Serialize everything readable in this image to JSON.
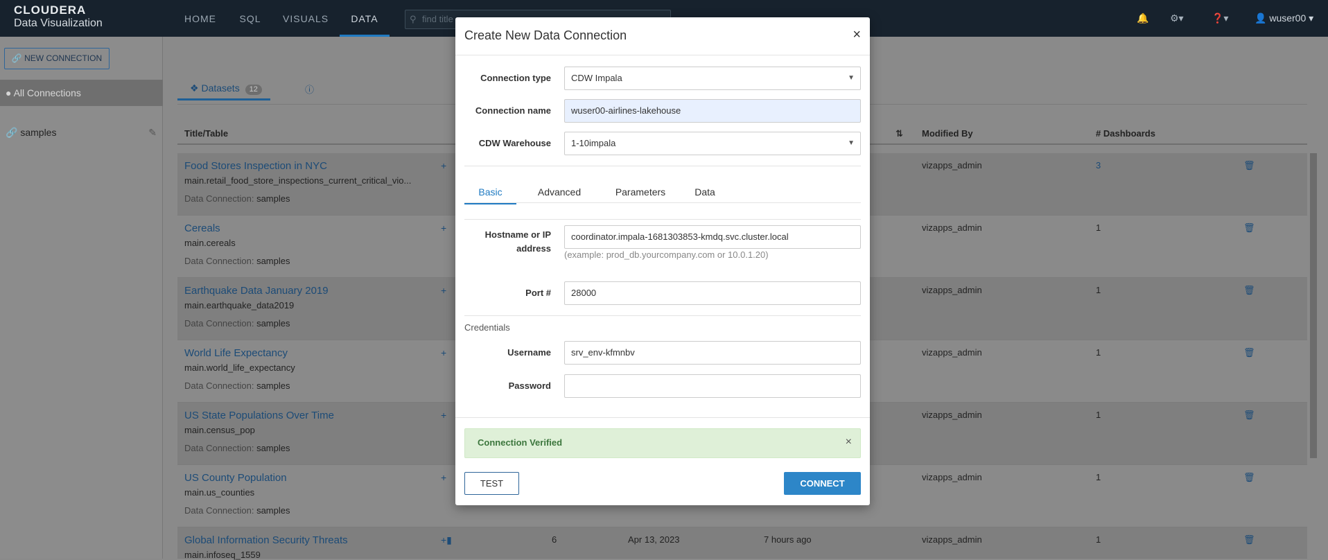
{
  "brand": {
    "line1": "CLOUDERA",
    "line2": "Data Visualization"
  },
  "nav": {
    "home": "HOME",
    "sql": "SQL",
    "visuals": "VISUALS",
    "data": "DATA"
  },
  "search": {
    "placeholder": "find title"
  },
  "user": {
    "name": "wuser00"
  },
  "sidebar": {
    "new_connection": "NEW CONNECTION",
    "all_connections": "All Connections",
    "connection": "samples"
  },
  "main": {
    "tab_datasets": "Datasets",
    "tab_count": "12",
    "columns": {
      "title": "Title/Table",
      "modified_by": "Modified By",
      "dashboards": "# Dashboards"
    },
    "dc_label": "Data Connection:",
    "rows": [
      {
        "title": "Food Stores Inspection in NYC",
        "table": "main.retail_food_store_inspections_current_critical_vio...",
        "conn": "samples",
        "modified_by": "vizapps_admin",
        "dashboards": "3"
      },
      {
        "title": "Cereals",
        "table": "main.cereals",
        "conn": "samples",
        "modified_by": "vizapps_admin",
        "dashboards": "1"
      },
      {
        "title": "Earthquake Data January 2019",
        "table": "main.earthquake_data2019",
        "conn": "samples",
        "modified_by": "vizapps_admin",
        "dashboards": "1"
      },
      {
        "title": "World Life Expectancy",
        "table": "main.world_life_expectancy",
        "conn": "samples",
        "modified_by": "vizapps_admin",
        "dashboards": "1"
      },
      {
        "title": "US State Populations Over Time",
        "table": "main.census_pop",
        "conn": "samples",
        "modified_by": "vizapps_admin",
        "dashboards": "1"
      },
      {
        "title": "US County Population",
        "table": "main.us_counties",
        "conn": "samples",
        "modified_by": "vizapps_admin",
        "dashboards": "1"
      },
      {
        "title": "Global Information Security Threats",
        "table": "main.infoseq_1559",
        "col3": "6",
        "col4": "Apr 13, 2023",
        "col5": "7 hours ago",
        "modified_by": "vizapps_admin",
        "dashboards": "1"
      }
    ]
  },
  "modal": {
    "title": "Create New Data Connection",
    "close": "×",
    "connection_type_label": "Connection type",
    "connection_type_value": "CDW Impala",
    "connection_name_label": "Connection name",
    "connection_name_value": "wuser00-airlines-lakehouse",
    "warehouse_label": "CDW Warehouse",
    "warehouse_value": "1-10impala",
    "tabs": [
      "Basic",
      "Advanced",
      "Parameters",
      "Data"
    ],
    "hostname_label_1": "Hostname or IP",
    "hostname_label_2": "address",
    "hostname_value": "coordinator.impala-1681303853-kmdq.svc.cluster.local",
    "hostname_hint": "(example: prod_db.yourcompany.com or 10.0.1.20)",
    "port_label": "Port #",
    "port_value": "28000",
    "credentials_label": "Credentials",
    "username_label": "Username",
    "username_value": "srv_env-kfmnbv",
    "password_label": "Password",
    "password_value": "",
    "alert_text": "Connection Verified",
    "test_label": "TEST",
    "connect_label": "CONNECT"
  }
}
